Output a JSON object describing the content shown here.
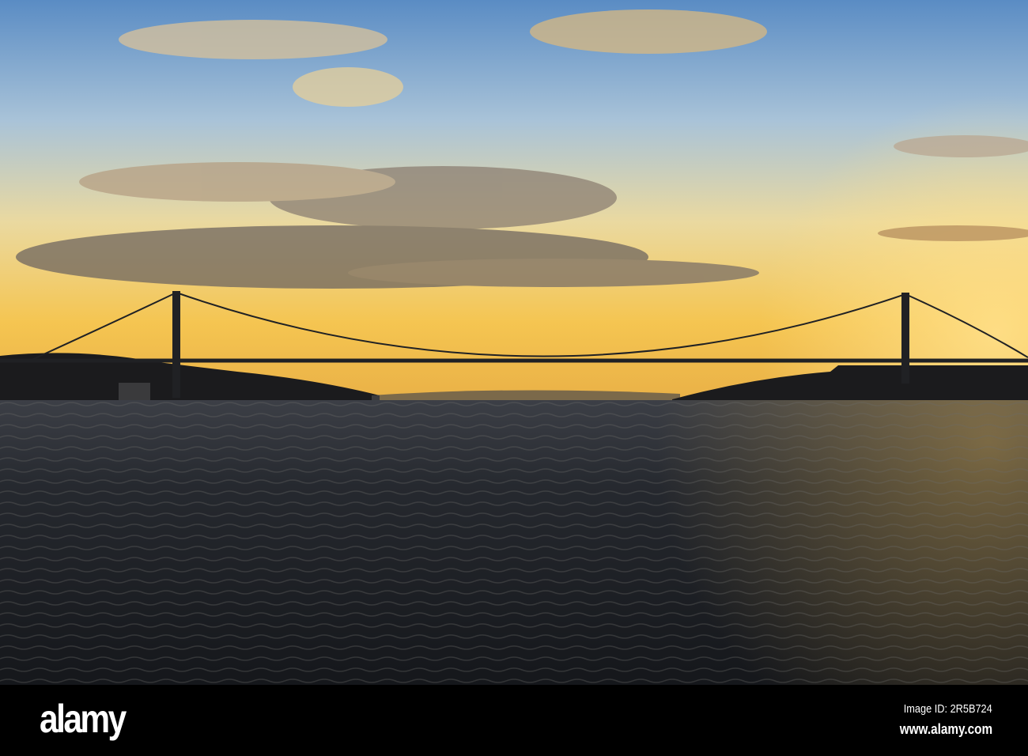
{
  "photo": {
    "subject": "Suspension bridge over a strait at sunset",
    "colors": {
      "sky_top": "#5d8fc6",
      "sky_horizon": "#f6c24a",
      "water": "#1f2228",
      "silhouette": "#1a1a1c"
    }
  },
  "watermark": {
    "logo": "alamy",
    "image_id": "Image ID: 2R5B724",
    "site": "www.alamy.com"
  }
}
